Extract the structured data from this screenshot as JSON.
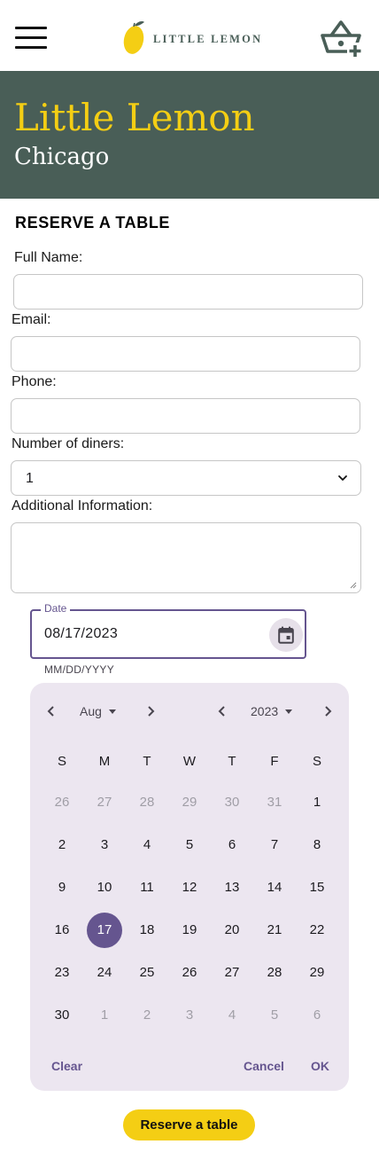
{
  "brand": {
    "logo_text": "LITTLE LEMON"
  },
  "hero": {
    "title": "Little Lemon",
    "subtitle": "Chicago"
  },
  "form": {
    "heading": "RESERVE A TABLE",
    "full_name_label": "Full Name:",
    "full_name_value": "",
    "email_label": "Email:",
    "email_value": "",
    "phone_label": "Phone:",
    "phone_value": "",
    "diners_label": "Number of diners:",
    "diners_value": "1",
    "additional_label": "Additional Information:",
    "additional_value": "",
    "date_label": "Date",
    "date_value": "08/17/2023",
    "date_helper": "MM/DD/YYYY",
    "submit_label": "Reserve a table"
  },
  "calendar": {
    "month": "Aug",
    "year": "2023",
    "weekdays": [
      "S",
      "M",
      "T",
      "W",
      "T",
      "F",
      "S"
    ],
    "selected_day": "17",
    "weeks": [
      [
        {
          "d": "26",
          "m": true
        },
        {
          "d": "27",
          "m": true
        },
        {
          "d": "28",
          "m": true
        },
        {
          "d": "29",
          "m": true
        },
        {
          "d": "30",
          "m": true
        },
        {
          "d": "31",
          "m": true
        },
        {
          "d": "1"
        }
      ],
      [
        {
          "d": "2"
        },
        {
          "d": "3"
        },
        {
          "d": "4"
        },
        {
          "d": "5"
        },
        {
          "d": "6"
        },
        {
          "d": "7"
        },
        {
          "d": "8"
        }
      ],
      [
        {
          "d": "9"
        },
        {
          "d": "10"
        },
        {
          "d": "11"
        },
        {
          "d": "12"
        },
        {
          "d": "13"
        },
        {
          "d": "14"
        },
        {
          "d": "15"
        }
      ],
      [
        {
          "d": "16"
        },
        {
          "d": "17",
          "s": true
        },
        {
          "d": "18"
        },
        {
          "d": "19"
        },
        {
          "d": "20"
        },
        {
          "d": "21"
        },
        {
          "d": "22"
        }
      ],
      [
        {
          "d": "23"
        },
        {
          "d": "24"
        },
        {
          "d": "25"
        },
        {
          "d": "26"
        },
        {
          "d": "27"
        },
        {
          "d": "28"
        },
        {
          "d": "29"
        }
      ],
      [
        {
          "d": "30"
        },
        {
          "d": "1",
          "m": true
        },
        {
          "d": "2",
          "m": true
        },
        {
          "d": "3",
          "m": true
        },
        {
          "d": "4",
          "m": true
        },
        {
          "d": "5",
          "m": true
        },
        {
          "d": "6",
          "m": true
        }
      ]
    ],
    "clear_label": "Clear",
    "cancel_label": "Cancel",
    "ok_label": "OK"
  },
  "icons": {
    "menu": "hamburger-menu-icon",
    "logo": "lemon-icon",
    "basket": "basket-add-icon",
    "calendar": "calendar-icon",
    "dropdown": "chevron-down-icon"
  },
  "colors": {
    "primary_green": "#495e57",
    "primary_yellow": "#f4ce14",
    "accent_purple": "#65558f",
    "calendar_bg": "#ece6f0"
  }
}
